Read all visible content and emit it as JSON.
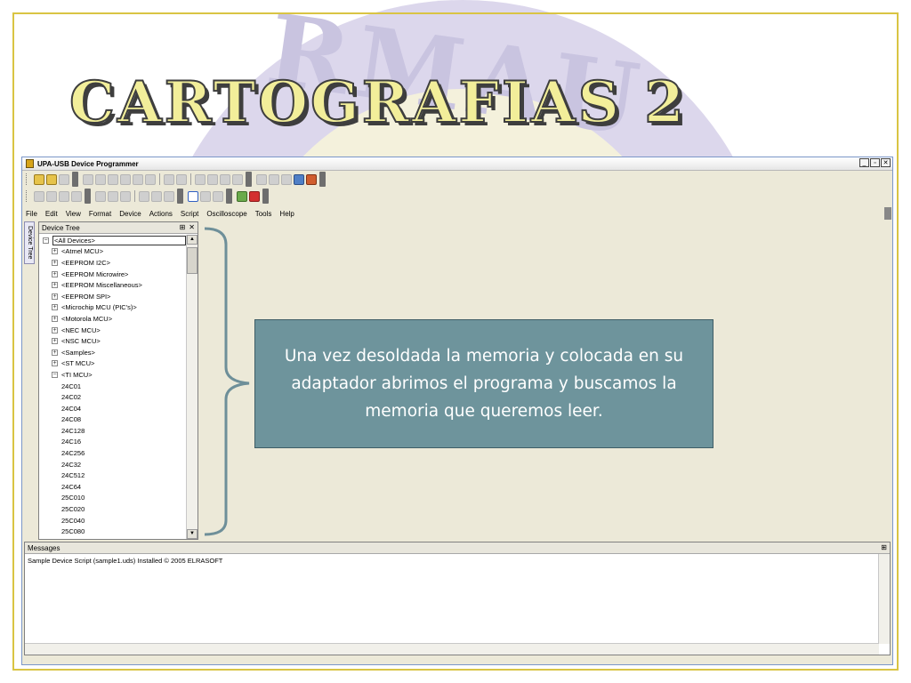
{
  "slide": {
    "title": "CARTOGRAFIAS 2",
    "callout_text": "Una vez desoldada la memoria y colocada en su adaptador abrimos el programa y buscamos la memoria que queremos leer.",
    "watermark_text": "RMAU",
    "colors": {
      "frame": "#d9c443",
      "title_fill": "#f2ee9a",
      "callout_bg": "#6e949c",
      "bracket": "#6e8f99"
    }
  },
  "window": {
    "title": "UPA-USB Device Programmer",
    "controls": [
      "_",
      "▫",
      "✕"
    ],
    "menu": [
      "File",
      "Edit",
      "View",
      "Format",
      "Device",
      "Actions",
      "Script",
      "Oscilloscope",
      "Tools",
      "Help"
    ]
  },
  "side_tab": {
    "label": "Device Tree"
  },
  "device_tree": {
    "header": "Device Tree",
    "header_buttons": [
      "⊞",
      "✕"
    ],
    "root": "<All Devices>",
    "groups": [
      "<Atmel MCU>",
      "<EEPROM I2C>",
      "<EEPROM Microwire>",
      "<EEPROM Miscellaneous>",
      "<EEPROM SPI>",
      "<Microchip MCU (PIC's)>",
      "<Motorola MCU>",
      "<NEC MCU>",
      "<NSC MCU>",
      "<Samples>",
      "<ST MCU>",
      "<TI MCU>"
    ],
    "devices": [
      "24C01",
      "24C02",
      "24C04",
      "24C08",
      "24C128",
      "24C16",
      "24C256",
      "24C32",
      "24C512",
      "24C64",
      "25C010",
      "25C020",
      "25C040",
      "25C080"
    ]
  },
  "messages": {
    "header": "Messages",
    "header_button": "⊞",
    "lines": [
      "Sample Device Script (sample1.uds) Installed © 2005 ELRASOFT"
    ]
  }
}
